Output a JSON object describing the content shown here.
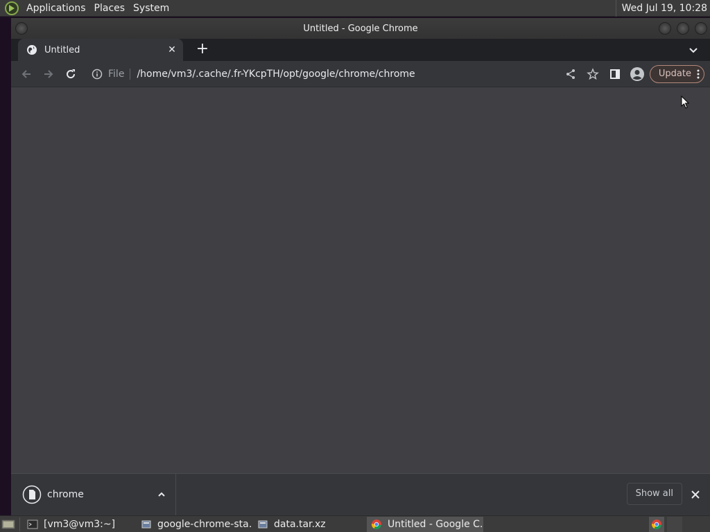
{
  "top_panel": {
    "menus": [
      "Applications",
      "Places",
      "System"
    ],
    "clock": "Wed Jul 19, 10:28"
  },
  "window": {
    "title": "Untitled - Google Chrome"
  },
  "tabs": [
    {
      "title": "Untitled",
      "icon": "globe-icon"
    }
  ],
  "toolbar": {
    "scheme": "File",
    "url": "/home/vm3/.cache/.fr-YKcpTH/opt/google/chrome/chrome",
    "update_label": "Update"
  },
  "download_shelf": {
    "items": [
      {
        "name": "chrome"
      }
    ],
    "show_all_label": "Show all"
  },
  "taskbar": {
    "tasks": [
      {
        "label": "[vm3@vm3:~]",
        "icon": "terminal-icon",
        "active": false
      },
      {
        "label": "google-chrome-sta…",
        "icon": "archive-icon",
        "active": false
      },
      {
        "label": "data.tar.xz",
        "icon": "archive-icon",
        "active": false
      },
      {
        "label": "Untitled - Google C…",
        "icon": "chrome-icon",
        "active": true
      }
    ]
  },
  "colors": {
    "content_bg": "#3f3f44",
    "toolbar_bg": "#35363a",
    "frame_bg": "#202124",
    "update_border": "#b48a7a"
  }
}
